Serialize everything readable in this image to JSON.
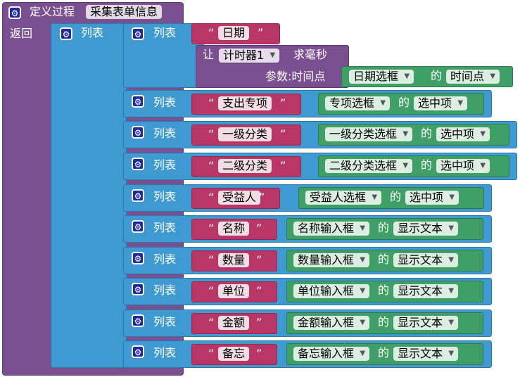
{
  "procedure": {
    "title": "定义过程",
    "name": "采集表单信息",
    "return_label": "返回"
  },
  "list_label": "列表",
  "gear_icon": "gear-icon",
  "of_label": "的",
  "date_row": {
    "string": "日期",
    "call_label": "让",
    "timer": "计时器1",
    "method": "求毫秒",
    "param_label": "参数:时间点",
    "picker": "日期选框",
    "property": "时间点"
  },
  "rows": [
    {
      "string": "支出专项",
      "component": "专项选框",
      "property": "选中项"
    },
    {
      "string": "一级分类",
      "component": "一级分类选框",
      "property": "选中项"
    },
    {
      "string": "二级分类",
      "component": "二级分类选框",
      "property": "选中项"
    },
    {
      "string": "受益人",
      "component": "受益人选框",
      "property": "选中项"
    },
    {
      "string": "名称",
      "component": "名称输入框",
      "property": "显示文本"
    },
    {
      "string": "数量",
      "component": "数量输入框",
      "property": "显示文本"
    },
    {
      "string": "单位",
      "component": "单位输入框",
      "property": "显示文本"
    },
    {
      "string": "金额",
      "component": "金额输入框",
      "property": "显示文本"
    },
    {
      "string": "备忘",
      "component": "备忘输入框",
      "property": "显示文本"
    }
  ],
  "colors": {
    "procedure": "#7a5090",
    "list": "#3f9ad1",
    "string": "#b83766",
    "component": "#3f9f67"
  }
}
